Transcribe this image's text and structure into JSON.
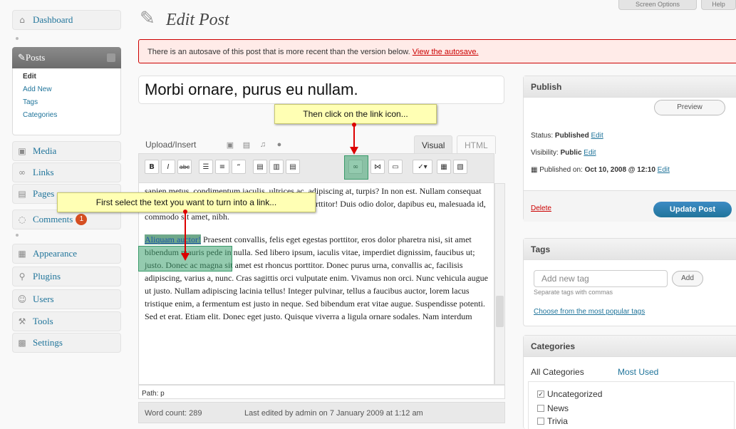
{
  "sidebar": {
    "dashboard": "Dashboard",
    "posts": "Posts",
    "posts_sub": [
      "Edit",
      "Add New",
      "Tags",
      "Categories"
    ],
    "media": "Media",
    "links": "Links",
    "pages": "Pages",
    "comments": "Comments",
    "comments_badge": "1",
    "appearance": "Appearance",
    "plugins": "Plugins",
    "users": "Users",
    "tools": "Tools",
    "settings": "Settings"
  },
  "header": {
    "title": "Edit Post",
    "screen_options": "Screen Options",
    "help": "Help"
  },
  "notice": {
    "text": "There is an autosave of this post that is more recent than the version below.",
    "link": "View the autosave."
  },
  "post": {
    "title": "Morbi ornare, purus eu nullam."
  },
  "editor": {
    "upload_label": "Upload/Insert",
    "tab_visual": "Visual",
    "tab_html": "HTML",
    "paragraph1": "sapien metus, condimentum iaculis, ultrices ac, adipiscing at, turpis? In non est. Nullam consequat lorem! Phasellus in metus sit amet eros viverra porttitor! Duis odio dolor, dapibus eu, malesuada id, commodo sit amet, nibh.",
    "selected_text": "Aliquam auctor!",
    "paragraph2": " Praesent convallis, felis eget egestas porttitor, eros dolor pharetra nisi, sit amet bibendum mauris pede in nulla. Sed libero ipsum, iaculis vitae, imperdiet dignissim, faucibus ut; justo. Donec ac magna sit amet est rhoncus porttitor. Donec purus urna, convallis ac, facilisis adipiscing, varius a, nunc. Cras sagittis orci vulputate enim. Vivamus non orci. Nunc vehicula augue ut justo. Nullam adipiscing lacinia tellus! Integer pulvinar, tellus a faucibus auctor, lorem lacus tristique enim, a fermentum est justo in neque. Sed bibendum erat vitae augue. Suspendisse potenti. Sed et erat. Etiam elit. Donec eget justo. Quisque viverra a ligula ornare sodales. Nam interdum",
    "path": "Path: p",
    "word_count": "Word count: 289",
    "last_edited": "Last edited by admin on 7 January 2009 at 1:12 am"
  },
  "publish": {
    "heading": "Publish",
    "preview": "Preview",
    "status_label": "Status:",
    "status_value": "Published",
    "visibility_label": "Visibility:",
    "visibility_value": "Public",
    "published_label": "Published on:",
    "published_value": "Oct 10, 2008 @ 12:10",
    "edit": "Edit",
    "delete": "Delete",
    "update": "Update Post"
  },
  "tags": {
    "heading": "Tags",
    "placeholder": "Add new tag",
    "add": "Add",
    "hint": "Separate tags with commas",
    "choose": "Choose from the most popular tags"
  },
  "categories": {
    "heading": "Categories",
    "tab_all": "All Categories",
    "tab_used": "Most Used",
    "items": [
      "Uncategorized",
      "News",
      "Trivia"
    ]
  },
  "callouts": {
    "link_icon": "Then click on the link icon...",
    "select_text": "First select the text you want to turn into a link..."
  },
  "colors": {
    "accent": "#21759b",
    "notice_border": "#cc0000",
    "callout_bg": "#ffffb4",
    "highlight": "#3ca06e",
    "arrow": "#dd0000"
  }
}
